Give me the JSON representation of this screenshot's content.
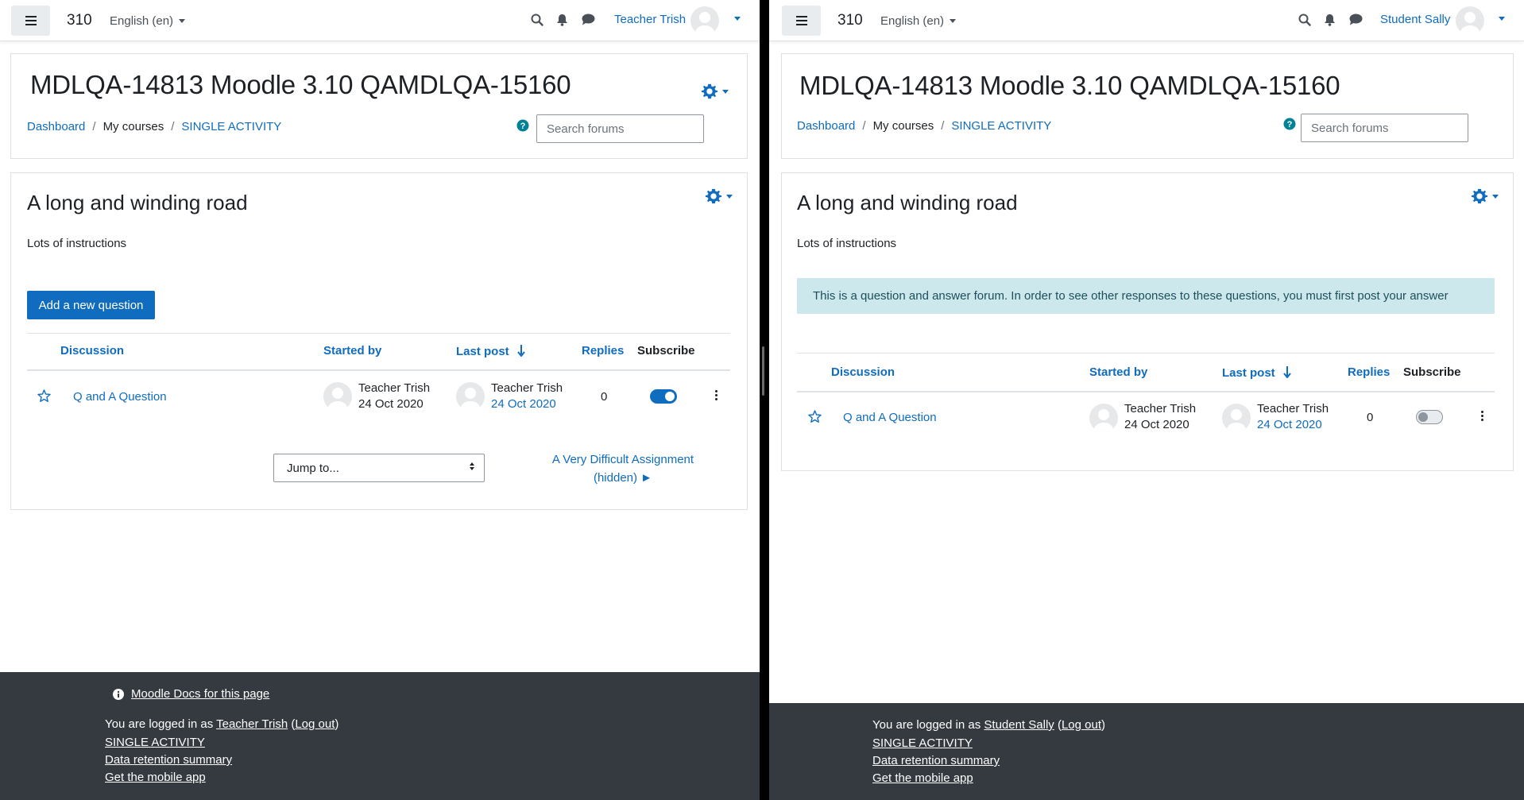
{
  "left": {
    "navbar": {
      "site_name": "310",
      "language": "English (en)",
      "user_name": "Teacher Trish"
    },
    "header": {
      "title": "MDLQA-14813 Moodle 3.10 QAMDLQA-15160",
      "breadcrumb": [
        "Dashboard",
        "My courses",
        "SINGLE ACTIVITY"
      ],
      "search_placeholder": "Search forums"
    },
    "forum": {
      "title": "A long and winding road",
      "intro": "Lots of instructions",
      "add_button": "Add a new question",
      "columns": [
        "Discussion",
        "Started by",
        "Last post",
        "Replies",
        "Subscribe"
      ],
      "rows": [
        {
          "discussion": "Q and A Question",
          "started_by": "Teacher Trish",
          "started_date": "24 Oct 2020",
          "last_post_by": "Teacher Trish",
          "last_post_date": "24 Oct 2020",
          "replies": "0",
          "subscribed": true
        }
      ],
      "jump_to": "Jump to...",
      "next_activity_line1": "A Very Difficult Assignment",
      "next_activity_line2": "(hidden) ►"
    },
    "footer": {
      "docs_link": "Moodle Docs for this page",
      "logged_in_prefix": "You are logged in as ",
      "user_name": "Teacher Trish",
      "logout_open": " (",
      "logout": "Log out",
      "logout_close": ")",
      "links": [
        "SINGLE ACTIVITY",
        "Data retention summary",
        "Get the mobile app"
      ]
    }
  },
  "right": {
    "navbar": {
      "site_name": "310",
      "language": "English (en)",
      "user_name": "Student Sally"
    },
    "header": {
      "title": "MDLQA-14813 Moodle 3.10 QAMDLQA-15160",
      "breadcrumb": [
        "Dashboard",
        "My courses",
        "SINGLE ACTIVITY"
      ],
      "search_placeholder": "Search forums"
    },
    "forum": {
      "title": "A long and winding road",
      "intro": "Lots of instructions",
      "notice": "This is a question and answer forum. In order to see other responses to these questions, you must first post your answer",
      "columns": [
        "Discussion",
        "Started by",
        "Last post",
        "Replies",
        "Subscribe"
      ],
      "rows": [
        {
          "discussion": "Q and A Question",
          "started_by": "Teacher Trish",
          "started_date": "24 Oct 2020",
          "last_post_by": "Teacher Trish",
          "last_post_date": "24 Oct 2020",
          "replies": "0",
          "subscribed": false
        }
      ]
    },
    "footer": {
      "logged_in_prefix": "You are logged in as ",
      "user_name": "Student Sally",
      "logout_open": " (",
      "logout": "Log out",
      "logout_close": ")",
      "links": [
        "SINGLE ACTIVITY",
        "Data retention summary",
        "Get the mobile app"
      ]
    }
  },
  "colors": {
    "primary": "#0f6cbf",
    "footer_bg": "#343a40",
    "notice_bg": "#cde8ed"
  },
  "icons": [
    "hamburger-icon",
    "search-icon",
    "bell-icon",
    "chat-icon",
    "gear-icon",
    "help-icon",
    "star-icon",
    "sort-down-icon",
    "kebab-icon",
    "info-icon"
  ]
}
